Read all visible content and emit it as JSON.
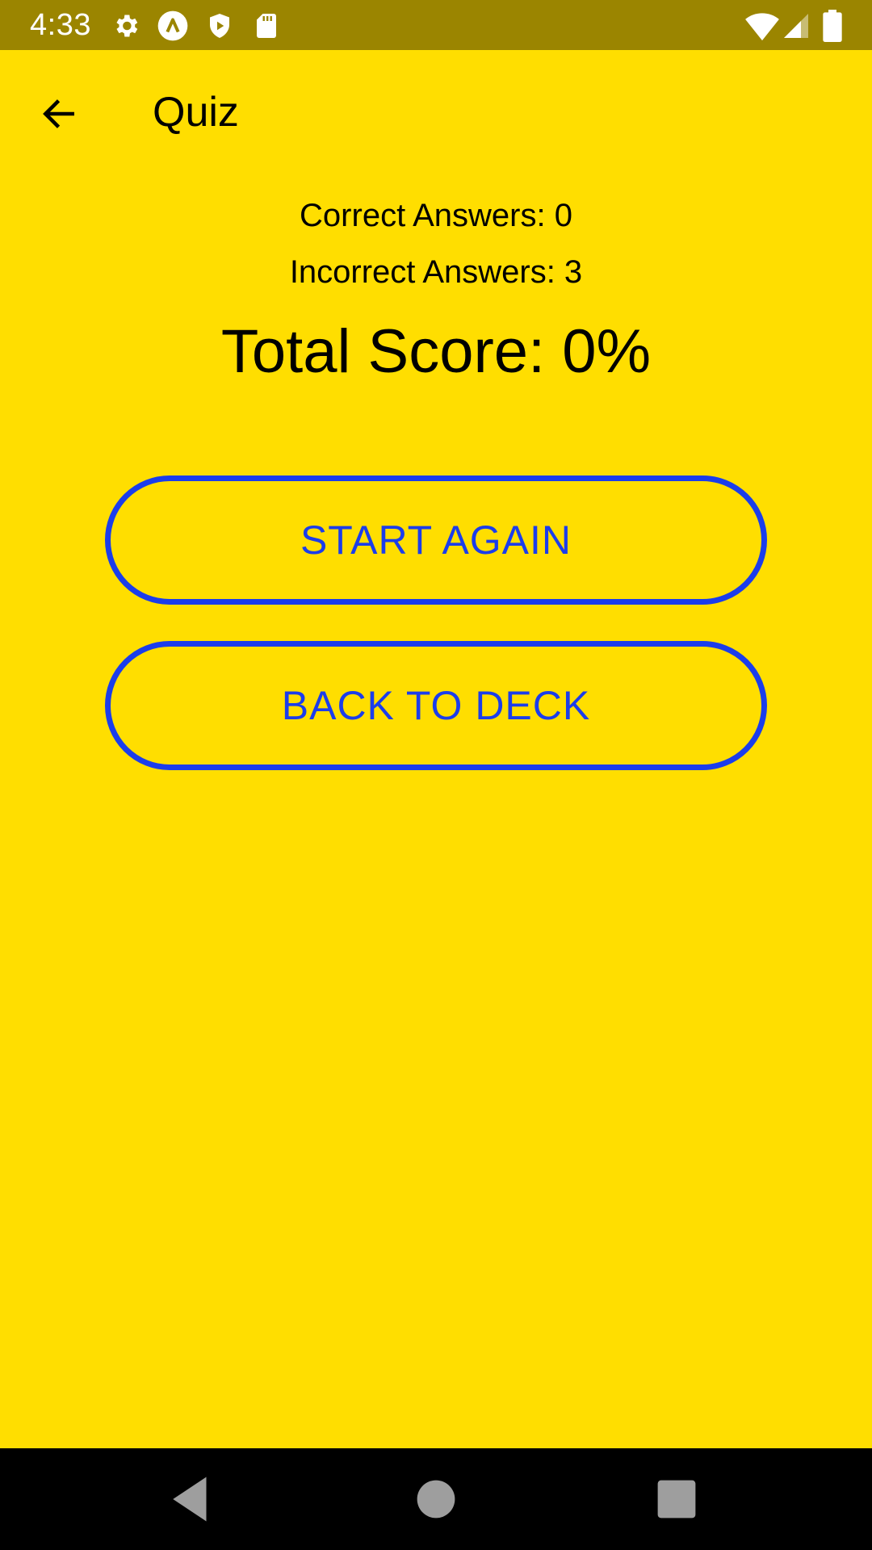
{
  "status_bar": {
    "time": "4:33",
    "left_icons": [
      "settings-icon",
      "app-a-icon",
      "shield-play-icon",
      "sd-card-icon"
    ],
    "right_icons": [
      "wifi-icon",
      "signal-icon",
      "battery-icon"
    ],
    "background_color": "#9B8500"
  },
  "app_bar": {
    "title": "Quiz",
    "back_icon": "arrow-left-icon"
  },
  "results": {
    "correct_answers": "Correct Answers: 0",
    "incorrect_answers": "Incorrect Answers: 3",
    "total_score": "Total Score: 0%"
  },
  "buttons": {
    "start_again": "START AGAIN",
    "back_to_deck": "BACK TO DECK"
  },
  "nav_bar": {
    "items": [
      "nav-back-icon",
      "nav-home-icon",
      "nav-recents-icon"
    ]
  },
  "colors": {
    "background": "#FFDE00",
    "accent": "#1B3DEB",
    "text": "#000000",
    "nav_bar": "#000000"
  }
}
